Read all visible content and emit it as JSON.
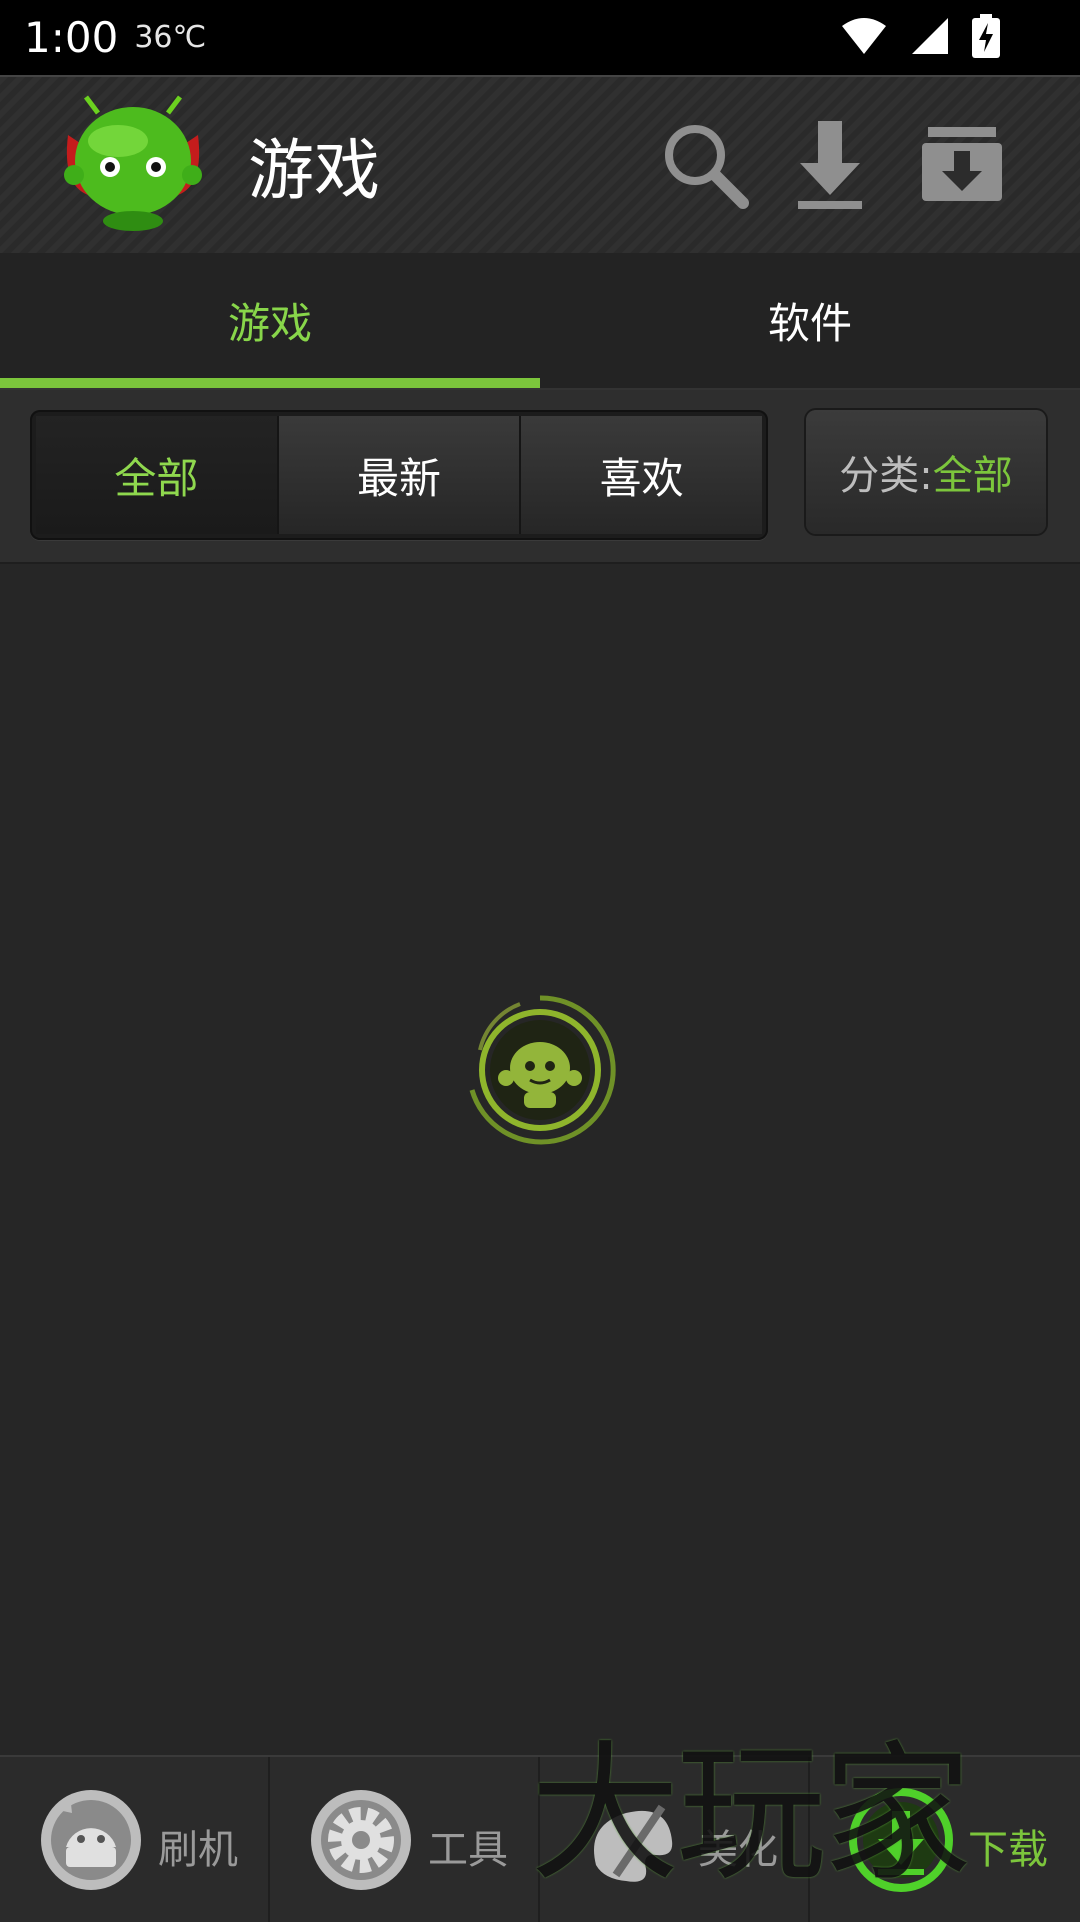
{
  "status_bar": {
    "time": "1:00",
    "temperature": "36℃"
  },
  "app_bar": {
    "title": "游戏"
  },
  "tabs": [
    {
      "label": "游戏",
      "selected": true
    },
    {
      "label": "软件",
      "selected": false
    }
  ],
  "filters": {
    "segments": [
      {
        "label": "全部",
        "selected": true
      },
      {
        "label": "最新",
        "selected": false
      },
      {
        "label": "喜欢",
        "selected": false
      }
    ],
    "category": {
      "label": "分类:",
      "value": "全部"
    }
  },
  "bottom_nav": [
    {
      "label": "刷机",
      "icon": "android-refresh-icon"
    },
    {
      "label": "工具",
      "icon": "gear-icon"
    },
    {
      "label": "美化",
      "icon": "palette-icon"
    },
    {
      "label": "下载",
      "icon": "download-icon",
      "selected": true
    }
  ],
  "watermark": {
    "text": "大玩家"
  },
  "colors": {
    "accent": "#7cc63c",
    "background": "#262626"
  }
}
